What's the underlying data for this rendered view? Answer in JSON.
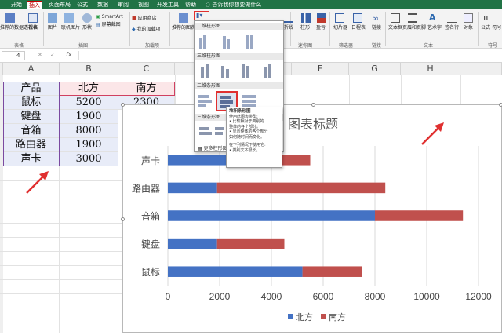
{
  "tabs": [
    "开始",
    "插入",
    "页面布局",
    "公式",
    "数据",
    "审阅",
    "视图",
    "开发工具",
    "帮助"
  ],
  "active_tab": 1,
  "tell_me": "告诉我你想要做什么",
  "ribbon": {
    "buttons": [
      "推荐的数据透视表",
      "表格",
      "图片",
      "联机图片",
      "形状",
      "SmartArt",
      "屏幕截图",
      "应用商店",
      "我的加载项",
      "推荐的图表",
      "折线",
      "柱形",
      "盈亏",
      "切片器",
      "日程表",
      "链接",
      "文本框",
      "页眉和页脚",
      "艺术字",
      "签名行",
      "对象",
      "公式",
      "符号"
    ],
    "groups": [
      "表格",
      "插图",
      "加载项",
      "迷你图",
      "筛选器",
      "链接",
      "文本",
      "符号"
    ]
  },
  "formula_bar": {
    "namebox": "4",
    "fx": "fx"
  },
  "columns": [
    "A",
    "B",
    "C",
    "D",
    "E",
    "F",
    "G",
    "H"
  ],
  "table": {
    "headers": [
      "产品",
      "北方",
      "南方"
    ],
    "rows": [
      [
        "鼠标",
        "5200",
        "2300"
      ],
      [
        "键盘",
        "1900",
        ""
      ],
      [
        "音箱",
        "8000",
        ""
      ],
      [
        "路由器",
        "1900",
        ""
      ],
      [
        "声卡",
        "3000",
        ""
      ]
    ]
  },
  "dropdown": {
    "sections": [
      "二维柱形图",
      "三维柱形图",
      "二维条形图",
      "三维条形图"
    ],
    "more": "更多柱形图(M)..."
  },
  "tooltip": {
    "title": "堆积条形图",
    "lines": [
      "使用此图表类型:",
      "• 比较相对于类别的",
      "整体的各个部分。",
      "• 显示整体的各个部分",
      "如何随时间而变化。",
      "",
      "在下列情况下使用它:",
      "• 类别文本很长。"
    ]
  },
  "chart_data": {
    "type": "bar",
    "orientation": "horizontal",
    "stacked": true,
    "title": "图表标题",
    "categories": [
      "鼠标",
      "键盘",
      "音箱",
      "路由器",
      "声卡"
    ],
    "series": [
      {
        "name": "北方",
        "values": [
          5200,
          1900,
          8000,
          1900,
          3000
        ],
        "color": "#4472c4"
      },
      {
        "name": "南方",
        "values": [
          2300,
          2600,
          3400,
          6500,
          2500
        ],
        "color": "#c0504d"
      }
    ],
    "xlim": [
      0,
      12000
    ],
    "xticks": [
      0,
      2000,
      4000,
      6000,
      8000,
      10000,
      12000
    ],
    "grid": true,
    "legend": "bottom"
  },
  "colors": {
    "ribbon_green": "#217346",
    "arrow_red": "#e03030"
  }
}
